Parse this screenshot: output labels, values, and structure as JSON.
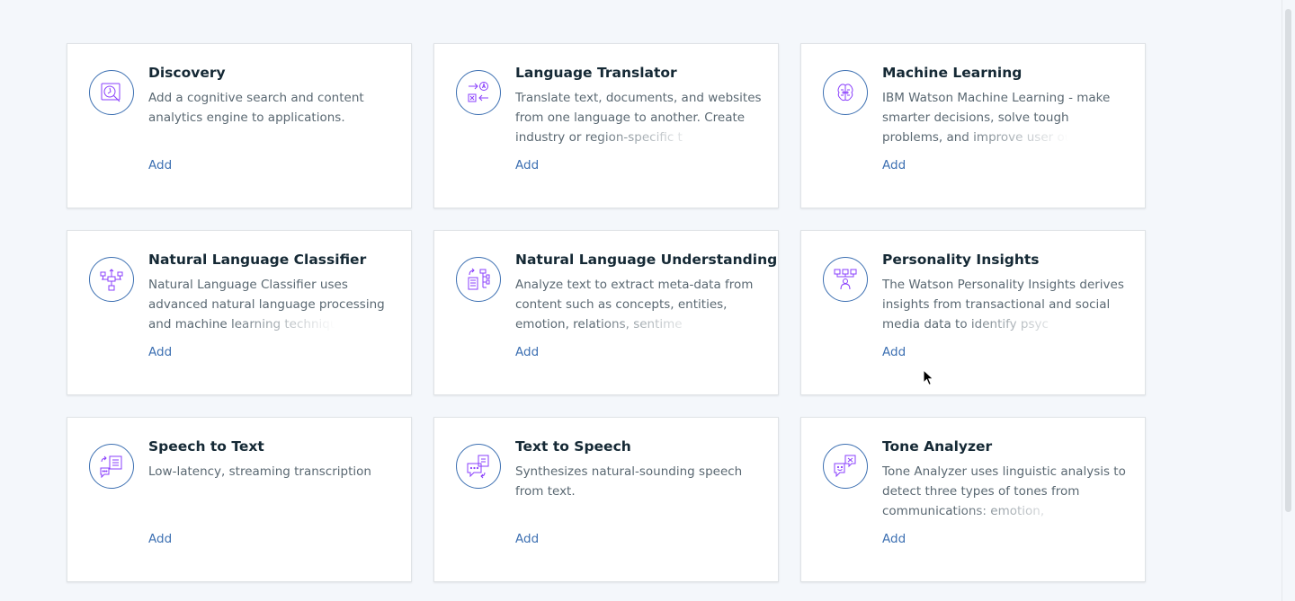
{
  "colors": {
    "icon_stroke": "#8a3ffc",
    "icon_ring": "#3d70b2",
    "link": "#3d70b2"
  },
  "cards": [
    {
      "title": "Discovery",
      "description": "Add a cognitive search and content analytics engine to applications.",
      "action": "Add",
      "icon": "discovery-icon"
    },
    {
      "title": "Language Translator",
      "description": "Translate text, documents, and websites from one language to another. Create industry or region-specific t",
      "action": "Add",
      "icon": "translator-icon"
    },
    {
      "title": "Machine Learning",
      "description": "IBM Watson Machine Learning - make smarter decisions, solve tough problems, and improve user outcome",
      "action": "Add",
      "icon": "brain-icon"
    },
    {
      "title": "Natural Language Classifier",
      "description": "Natural Language Classifier uses advanced natural language processing and machine learning techniques to crea",
      "action": "Add",
      "icon": "classifier-icon"
    },
    {
      "title": "Natural Language Understanding",
      "description": "Analyze text to extract meta-data from content such as concepts, entities, emotion, relations, sentime",
      "action": "Add",
      "icon": "nlu-icon"
    },
    {
      "title": "Personality Insights",
      "description": "The Watson Personality Insights derives insights from transactional and social media data to identify psyc",
      "action": "Add",
      "icon": "personality-icon"
    },
    {
      "title": "Speech to Text",
      "description": "Low-latency, streaming transcription",
      "action": "Add",
      "icon": "speech-to-text-icon"
    },
    {
      "title": "Text to Speech",
      "description": "Synthesizes natural-sounding speech from text.",
      "action": "Add",
      "icon": "text-to-speech-icon"
    },
    {
      "title": "Tone Analyzer",
      "description": "Tone Analyzer uses linguistic analysis to detect three types of tones from communications: emotion,",
      "action": "Add",
      "icon": "tone-analyzer-icon"
    }
  ]
}
